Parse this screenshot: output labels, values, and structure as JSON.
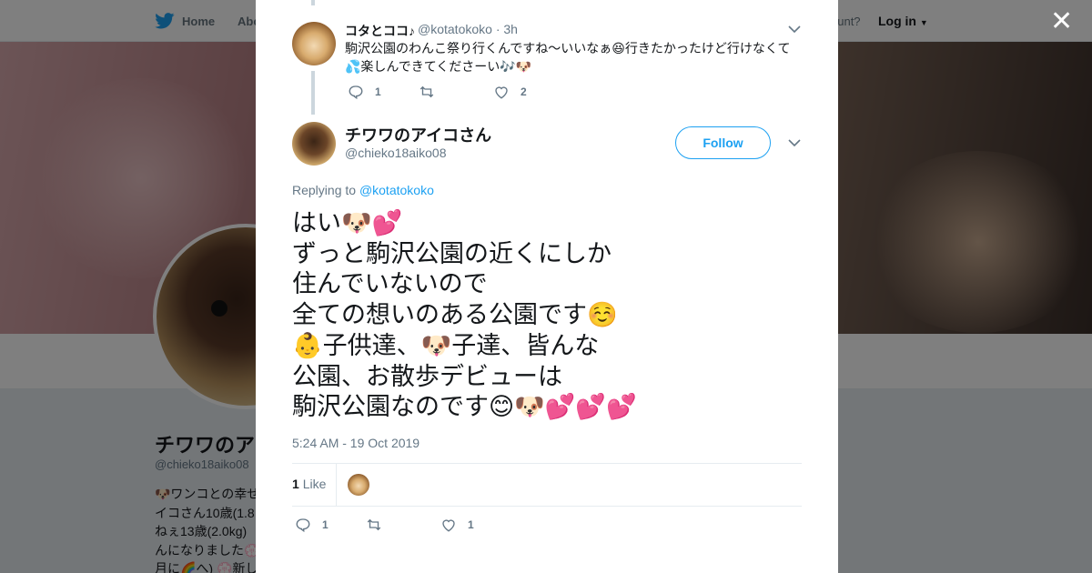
{
  "nav": {
    "home_label": "Home",
    "about_label": "Abo",
    "account_prompt": "ccount?",
    "login_label": "Log in"
  },
  "background_profile": {
    "name": "チワワのア",
    "handle": "@chieko18aiko08",
    "bio_lines": [
      "🐶ワンコとの幸せ",
      "イコさん10歳(1.8",
      "ねぇ13歳(2.0kg)",
      "んになりました💮",
      "月に🌈へ) 💮新し"
    ]
  },
  "parent_tweet": {
    "name": "コタとココ♪",
    "handle": "@kotatokoko",
    "time": "· 3h",
    "text_line1": "駒沢公園のわんこ祭り行くんですね〜いいなぁ😆行きたかったけど行けなくて",
    "text_line2": "💦楽しんできてくださーい🎶🐶",
    "reply_count": "1",
    "retweet_count": "",
    "like_count": "2"
  },
  "main_tweet": {
    "name": "チワワのアイコさん",
    "handle": "@chieko18aiko08",
    "follow_label": "Follow",
    "replying_prefix": "Replying to",
    "replying_to": "@kotatokoko",
    "lines": [
      "はい🐶💕",
      "ずっと駒沢公園の近くにしか",
      "住んでいないので",
      "全ての想いのある公園です☺️",
      "👶子供達、🐶子達、皆んな",
      "公園、お散歩デビューは",
      "駒沢公園なのです😊🐶💕💕💕"
    ],
    "timestamp": "5:24 AM - 19 Oct 2019",
    "likes_number": "1",
    "likes_word": "Like",
    "reply_count": "1",
    "retweet_count": "",
    "like_count": "1"
  },
  "colors": {
    "twitter_blue": "#1da1f2",
    "secondary_text": "#657786",
    "primary_text": "#14171a",
    "thread_line": "#ccd6dd"
  }
}
